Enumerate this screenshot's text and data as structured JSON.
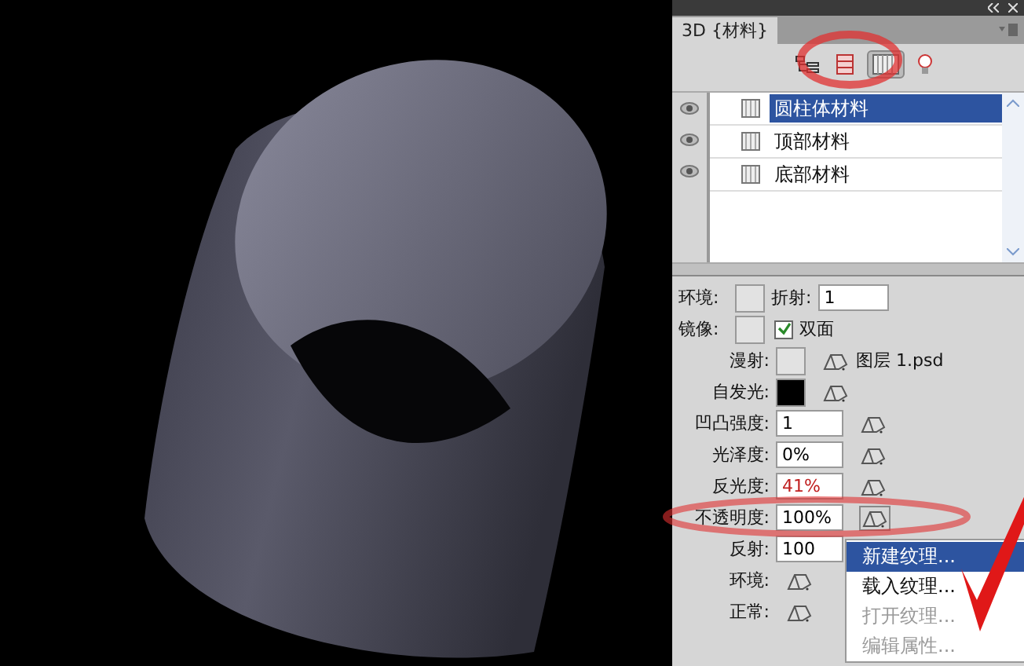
{
  "panel": {
    "title": "3D {材料}",
    "toolbar": [
      {
        "kind": "scene",
        "selected": false
      },
      {
        "kind": "mesh",
        "selected": false
      },
      {
        "kind": "material",
        "selected": true
      },
      {
        "kind": "light",
        "selected": false
      }
    ]
  },
  "materials": [
    {
      "name": "圆柱体材料",
      "selected": true,
      "visible": true
    },
    {
      "name": "顶部材料",
      "selected": false,
      "visible": true
    },
    {
      "name": "底部材料",
      "selected": false,
      "visible": true
    }
  ],
  "top_fields": [
    {
      "label": "环境:",
      "kind": "swatch",
      "second_label": "折射:",
      "second_value": "1"
    },
    {
      "label": "镜像:",
      "kind": "swatch",
      "check_label": "双面",
      "checked": true
    }
  ],
  "properties": [
    {
      "label": "漫射:",
      "kind": "swatch",
      "texture": "图层 1.psd"
    },
    {
      "label": "自发光:",
      "kind": "black_swatch"
    },
    {
      "label": "凹凸强度:",
      "kind": "input",
      "value": "1"
    },
    {
      "label": "光泽度:",
      "kind": "input",
      "value": "0%"
    },
    {
      "label": "反光度:",
      "kind": "input",
      "value": "41%"
    },
    {
      "label": "不透明度:",
      "kind": "input",
      "value": "100%"
    },
    {
      "label": "反射:",
      "kind": "input_plain",
      "value": "100"
    },
    {
      "label": "环境:",
      "kind": "icon"
    },
    {
      "label": "正常:",
      "kind": "icon"
    }
  ],
  "context_menu": [
    {
      "label": "新建纹理...",
      "selected": true,
      "disabled": false
    },
    {
      "label": "载入纹理...",
      "selected": false,
      "disabled": false
    },
    {
      "label": "打开纹理...",
      "selected": false,
      "disabled": true
    },
    {
      "label": "编辑属性...",
      "selected": false,
      "disabled": true
    }
  ]
}
